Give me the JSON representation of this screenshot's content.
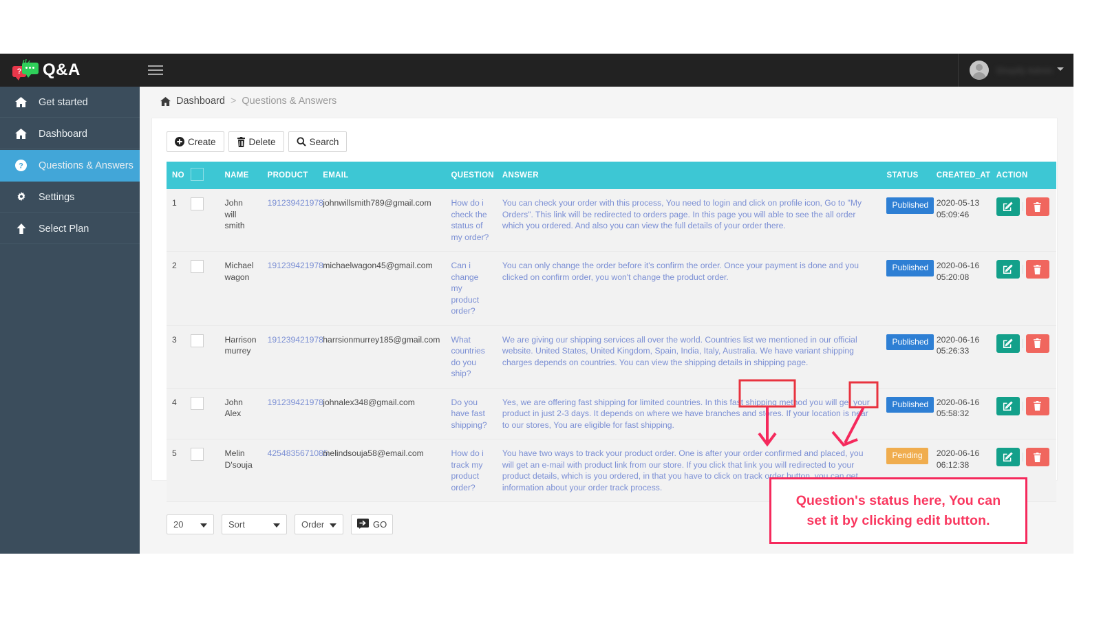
{
  "topbar": {
    "logo_text": "Q&A",
    "logo_icon": "qa-speech-bubbles-icon",
    "menu_icon": "hamburger-icon",
    "user_name": "Shopify Admin",
    "caret_icon": "chevron-down-icon"
  },
  "sidebar": {
    "items": [
      {
        "label": "Get started",
        "icon": "home-icon",
        "active": false
      },
      {
        "label": "Dashboard",
        "icon": "home-icon",
        "active": false
      },
      {
        "label": "Questions & Answers",
        "icon": "question-circle-icon",
        "active": true
      },
      {
        "label": "Settings",
        "icon": "gear-icon",
        "active": false
      },
      {
        "label": "Select Plan",
        "icon": "arrow-up-icon",
        "active": false
      }
    ]
  },
  "breadcrumb": {
    "home_icon": "home-icon",
    "item1": "Dashboard",
    "separator": ">",
    "item2": "Questions & Answers"
  },
  "toolbar": {
    "create_label": "Create",
    "delete_label": "Delete",
    "search_label": "Search",
    "create_icon": "plus-circle-icon",
    "delete_icon": "trash-icon",
    "search_icon": "search-icon"
  },
  "table": {
    "columns": [
      "NO",
      "",
      "NAME",
      "PRODUCT",
      "EMAIL",
      "QUESTION",
      "ANSWER",
      "STATUS",
      "CREATED_AT",
      "ACTION"
    ],
    "select_all_checkbox": "select-all-checkbox",
    "rows": [
      {
        "no": "1",
        "name": "John will smith",
        "product": "191239421978",
        "email": "johnwillsmith789@gmail.com",
        "question": "How do i check the status of my order?",
        "answer": "You can check your order with this process, You need to login and click on profile icon, Go to \"My Orders\". This link will be redirected to orders page. In this page you will able to see the all order which you ordered. And also you can view the full details of your order there.",
        "status": "Published",
        "status_kind": "published",
        "created_at_date": "2020-05-13",
        "created_at_time": "05:09:46"
      },
      {
        "no": "2",
        "name": "Michael wagon",
        "product": "191239421978",
        "email": "michaelwagon45@gmail.com",
        "question": "Can i change my product order?",
        "answer": "You can only change the order before it's confirm the order. Once your payment is done and you clicked on confirm order, you won't change the product order.",
        "status": "Published",
        "status_kind": "published",
        "created_at_date": "2020-06-16",
        "created_at_time": "05:20:08"
      },
      {
        "no": "3",
        "name": "Harrison murrey",
        "product": "191239421978",
        "email": "harrsionmurrey185@gmail.com",
        "question": "What countries do you ship?",
        "answer": "We are giving our shipping services all over the world. Countries list we mentioned in our official website. United States, United Kingdom, Spain, India, Italy, Australia. We have variant shipping charges depends on countries. You can view the shipping details in shipping page.",
        "status": "Published",
        "status_kind": "published",
        "created_at_date": "2020-06-16",
        "created_at_time": "05:26:33"
      },
      {
        "no": "4",
        "name": "John Alex",
        "product": "191239421978",
        "email": "johnalex348@gmail.com",
        "question": "Do you have fast shipping?",
        "answer": "Yes, we are offering fast shipping for limited countries. In this fast shipping method you will get your product in just 2-3 days. It depends on where we have branches and stores. If your location is near to our stores, You are eligible for fast shipping.",
        "status": "Published",
        "status_kind": "published",
        "created_at_date": "2020-06-16",
        "created_at_time": "05:58:32"
      },
      {
        "no": "5",
        "name": "Melin D'souja",
        "product": "4254835671085",
        "email": "melindsouja58@email.com",
        "question": "How do i track my product order?",
        "answer": "You have two ways to track your product order. One is after your order confirmed and placed, you will get an e-mail with product link from our store. If you click that link you will redirected to your product details, which is you ordered, in that you have to click on track order button, you can get information about your order track process.",
        "status": "Pending",
        "status_kind": "pending",
        "created_at_date": "2020-06-16",
        "created_at_time": "06:12:38"
      }
    ],
    "edit_icon": "edit-pencil-icon",
    "delete_icon": "trash-icon"
  },
  "footer": {
    "per_page": "20",
    "sort": "Sort",
    "order": "Order",
    "go_label": "GO",
    "go_icon": "arrow-right-box-icon"
  },
  "annotation": {
    "line1": "Question's status here, You can",
    "line2": "set it by clicking edit button.",
    "color": "#f9375f"
  },
  "colors": {
    "topbar": "#222222",
    "sidebar": "#3b4d5c",
    "sidebar_active": "#42a6d8",
    "table_header": "#3dc7d4",
    "published_badge": "#2e7fd4",
    "pending_badge": "#f0ad4e",
    "edit_button": "#13a08a",
    "delete_button": "#f0665e",
    "annotation": "#f9375f"
  }
}
